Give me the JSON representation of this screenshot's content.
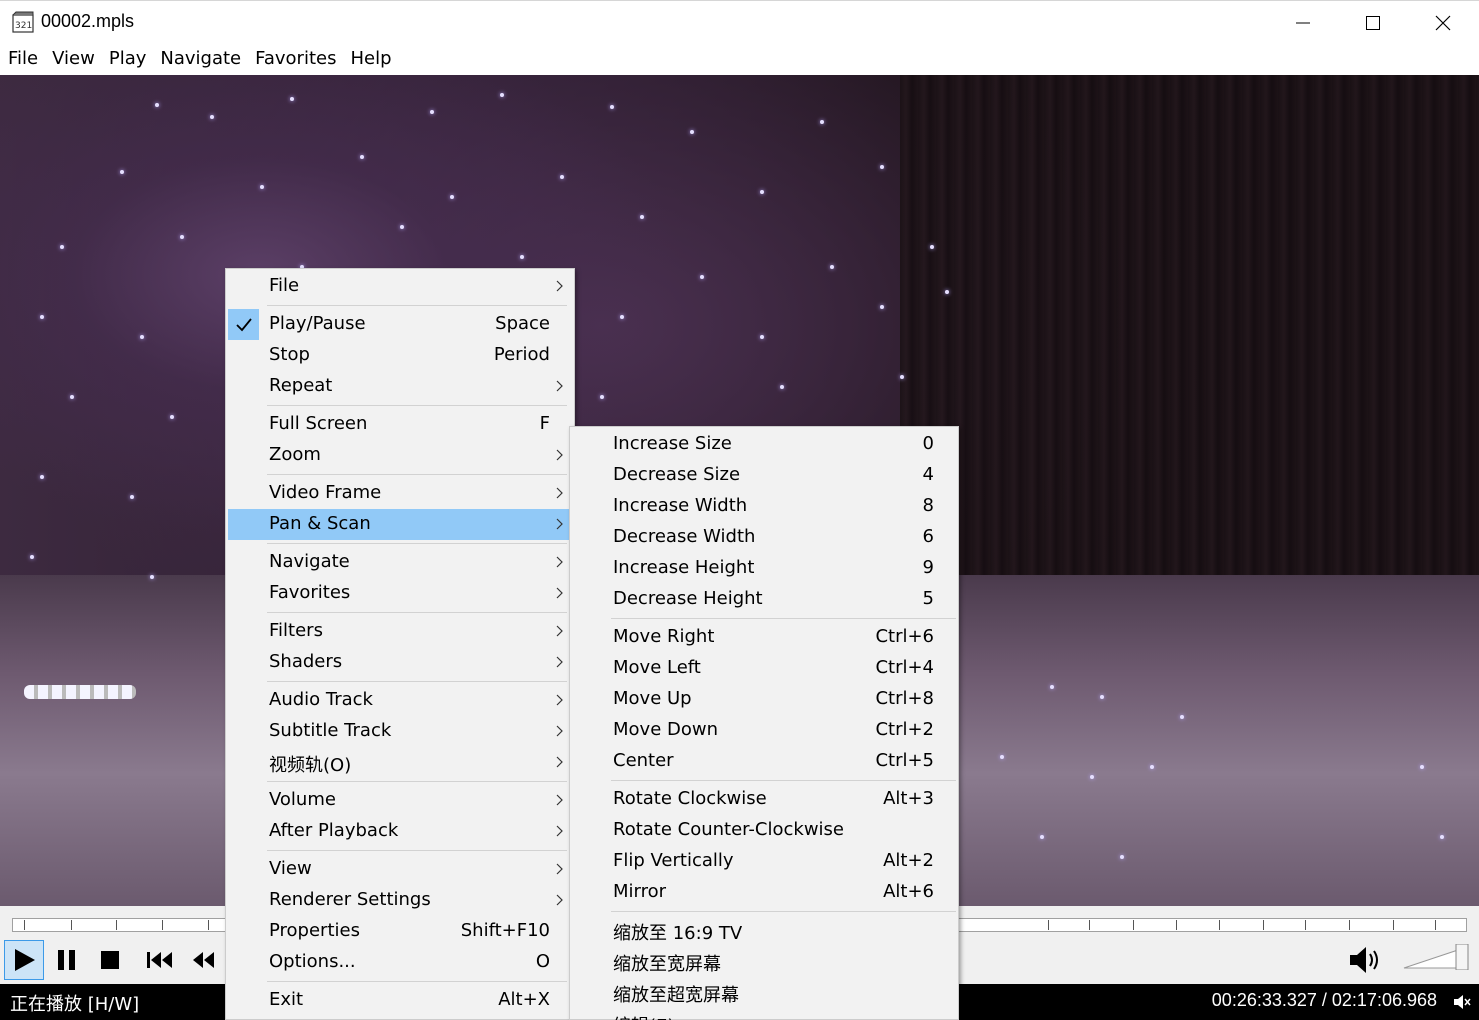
{
  "window": {
    "title": "00002.mpls",
    "minimize_icon": "minimize-icon",
    "maximize_icon": "maximize-icon",
    "close_icon": "close-icon"
  },
  "menubar": [
    "File",
    "View",
    "Play",
    "Navigate",
    "Favorites",
    "Help"
  ],
  "context_menu": {
    "items": [
      {
        "label": "File",
        "shortcut": "",
        "submenu": true,
        "checked": false,
        "highlight": false,
        "sep_before": false
      },
      {
        "label": "Play/Pause",
        "shortcut": "Space",
        "submenu": false,
        "checked": true,
        "highlight": false,
        "sep_before": true
      },
      {
        "label": "Stop",
        "shortcut": "Period",
        "submenu": false,
        "checked": false,
        "highlight": false,
        "sep_before": false
      },
      {
        "label": "Repeat",
        "shortcut": "",
        "submenu": true,
        "checked": false,
        "highlight": false,
        "sep_before": false
      },
      {
        "label": "Full Screen",
        "shortcut": "F",
        "submenu": false,
        "checked": false,
        "highlight": false,
        "sep_before": true
      },
      {
        "label": "Zoom",
        "shortcut": "",
        "submenu": true,
        "checked": false,
        "highlight": false,
        "sep_before": false
      },
      {
        "label": "Video Frame",
        "shortcut": "",
        "submenu": true,
        "checked": false,
        "highlight": false,
        "sep_before": true
      },
      {
        "label": "Pan & Scan",
        "shortcut": "",
        "submenu": true,
        "checked": false,
        "highlight": true,
        "sep_before": false
      },
      {
        "label": "Navigate",
        "shortcut": "",
        "submenu": true,
        "checked": false,
        "highlight": false,
        "sep_before": true
      },
      {
        "label": "Favorites",
        "shortcut": "",
        "submenu": true,
        "checked": false,
        "highlight": false,
        "sep_before": false
      },
      {
        "label": "Filters",
        "shortcut": "",
        "submenu": true,
        "checked": false,
        "highlight": false,
        "sep_before": true
      },
      {
        "label": "Shaders",
        "shortcut": "",
        "submenu": true,
        "checked": false,
        "highlight": false,
        "sep_before": false
      },
      {
        "label": "Audio Track",
        "shortcut": "",
        "submenu": true,
        "checked": false,
        "highlight": false,
        "sep_before": true
      },
      {
        "label": "Subtitle Track",
        "shortcut": "",
        "submenu": true,
        "checked": false,
        "highlight": false,
        "sep_before": false
      },
      {
        "label": "视频轨(O)",
        "shortcut": "",
        "submenu": true,
        "checked": false,
        "highlight": false,
        "sep_before": false
      },
      {
        "label": "Volume",
        "shortcut": "",
        "submenu": true,
        "checked": false,
        "highlight": false,
        "sep_before": true
      },
      {
        "label": "After Playback",
        "shortcut": "",
        "submenu": true,
        "checked": false,
        "highlight": false,
        "sep_before": false
      },
      {
        "label": "View",
        "shortcut": "",
        "submenu": true,
        "checked": false,
        "highlight": false,
        "sep_before": true
      },
      {
        "label": "Renderer Settings",
        "shortcut": "",
        "submenu": true,
        "checked": false,
        "highlight": false,
        "sep_before": false
      },
      {
        "label": "Properties",
        "shortcut": "Shift+F10",
        "submenu": false,
        "checked": false,
        "highlight": false,
        "sep_before": false
      },
      {
        "label": "Options...",
        "shortcut": "O",
        "submenu": false,
        "checked": false,
        "highlight": false,
        "sep_before": false
      },
      {
        "label": "Exit",
        "shortcut": "Alt+X",
        "submenu": false,
        "checked": false,
        "highlight": false,
        "sep_before": true
      }
    ]
  },
  "pan_scan_menu": {
    "items": [
      {
        "label": "Increase Size",
        "shortcut": "0",
        "sep_before": false
      },
      {
        "label": "Decrease Size",
        "shortcut": "4",
        "sep_before": false
      },
      {
        "label": "Increase Width",
        "shortcut": "8",
        "sep_before": false
      },
      {
        "label": "Decrease Width",
        "shortcut": "6",
        "sep_before": false
      },
      {
        "label": "Increase Height",
        "shortcut": "9",
        "sep_before": false
      },
      {
        "label": "Decrease Height",
        "shortcut": "5",
        "sep_before": false
      },
      {
        "label": "Move Right",
        "shortcut": "Ctrl+6",
        "sep_before": true
      },
      {
        "label": "Move Left",
        "shortcut": "Ctrl+4",
        "sep_before": false
      },
      {
        "label": "Move Up",
        "shortcut": "Ctrl+8",
        "sep_before": false
      },
      {
        "label": "Move Down",
        "shortcut": "Ctrl+2",
        "sep_before": false
      },
      {
        "label": "Center",
        "shortcut": "Ctrl+5",
        "sep_before": false
      },
      {
        "label": "Rotate Clockwise",
        "shortcut": "Alt+3",
        "sep_before": true
      },
      {
        "label": "Rotate Counter-Clockwise",
        "shortcut": "",
        "sep_before": false
      },
      {
        "label": "Flip Vertically",
        "shortcut": "Alt+2",
        "sep_before": false
      },
      {
        "label": "Mirror",
        "shortcut": "Alt+6",
        "sep_before": false
      },
      {
        "label": "缩放至 16:9 TV",
        "shortcut": "",
        "sep_before": true
      },
      {
        "label": "缩放至宽屏幕",
        "shortcut": "",
        "sep_before": false
      },
      {
        "label": "缩放至超宽屏幕",
        "shortcut": "",
        "sep_before": false
      },
      {
        "label": "编辑(E)",
        "shortcut": "",
        "sep_before": false
      }
    ]
  },
  "controls": {
    "buttons": [
      "play-icon",
      "pause-icon",
      "stop-icon",
      "skip-back-icon",
      "rewind-icon"
    ],
    "volume_icon": "speaker-icon"
  },
  "status": {
    "state": "正在播放 [H/W]",
    "time": "00:26:33.327 / 02:17:06.968"
  },
  "colors": {
    "menu_bg": "#f2f2f2",
    "highlight": "#91c9f7",
    "statusbar": "#000000"
  }
}
